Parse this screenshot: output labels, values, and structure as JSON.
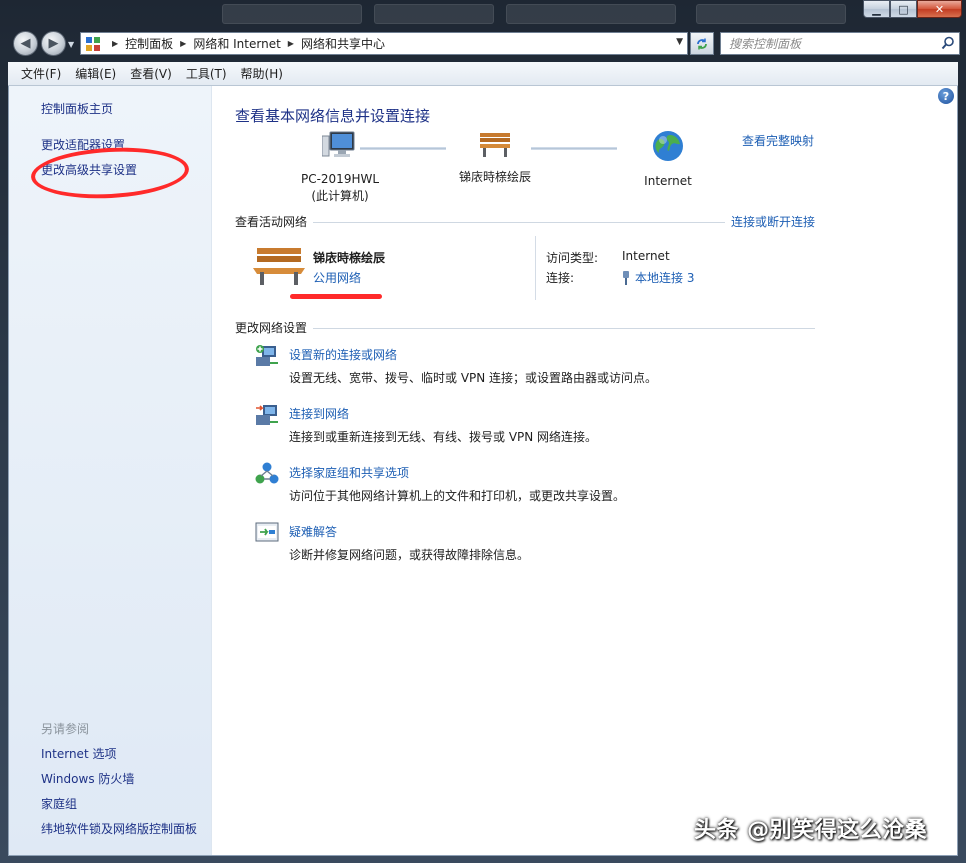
{
  "window": {
    "controls": {
      "minimize": "▁",
      "maximize": "□",
      "close": "✕"
    }
  },
  "nav": {
    "back": "◀",
    "forward": "▶",
    "breadcrumb": [
      "控制面板",
      "网络和 Internet",
      "网络和共享中心"
    ],
    "search_placeholder": "搜索控制面板"
  },
  "menu": [
    "文件(F)",
    "编辑(E)",
    "查看(V)",
    "工具(T)",
    "帮助(H)"
  ],
  "sidebar": {
    "items": [
      "控制面板主页",
      "更改适配器设置",
      "更改高级共享设置"
    ],
    "see_also_title": "另请参阅",
    "see_also": [
      "Internet 选项",
      "Windows 防火墙",
      "家庭组",
      "纬地软件锁及网络版控制面板"
    ]
  },
  "main": {
    "title": "查看基本网络信息并设置连接",
    "full_map": "查看完整映射",
    "nodes": [
      {
        "label1": "PC-2019HWL",
        "label2": "(此计算机)"
      },
      {
        "label1": "锑庡時榇绘辰",
        "label2": ""
      },
      {
        "label1": "Internet",
        "label2": ""
      }
    ],
    "active_header": "查看活动网络",
    "connect_disconnect": "连接或断开连接",
    "network": {
      "name": "锑庡時榇绘辰",
      "type": "公用网络",
      "access_label": "访问类型:",
      "access_value": "Internet",
      "conn_label": "连接:",
      "conn_value": "本地连接 3"
    },
    "change_header": "更改网络设置",
    "tasks": [
      {
        "title": "设置新的连接或网络",
        "desc": "设置无线、宽带、拨号、临时或 VPN 连接；或设置路由器或访问点。"
      },
      {
        "title": "连接到网络",
        "desc": "连接到或重新连接到无线、有线、拨号或 VPN 网络连接。"
      },
      {
        "title": "选择家庭组和共享选项",
        "desc": "访问位于其他网络计算机上的文件和打印机，或更改共享设置。"
      },
      {
        "title": "疑难解答",
        "desc": "诊断并修复网络问题，或获得故障排除信息。"
      }
    ]
  },
  "help_label": "?",
  "watermark": "头条 @别笑得这么沧桑",
  "colors": {
    "link": "#1e5fb4",
    "nav_link": "#1e3287",
    "annotation": "#ff2a2a"
  }
}
